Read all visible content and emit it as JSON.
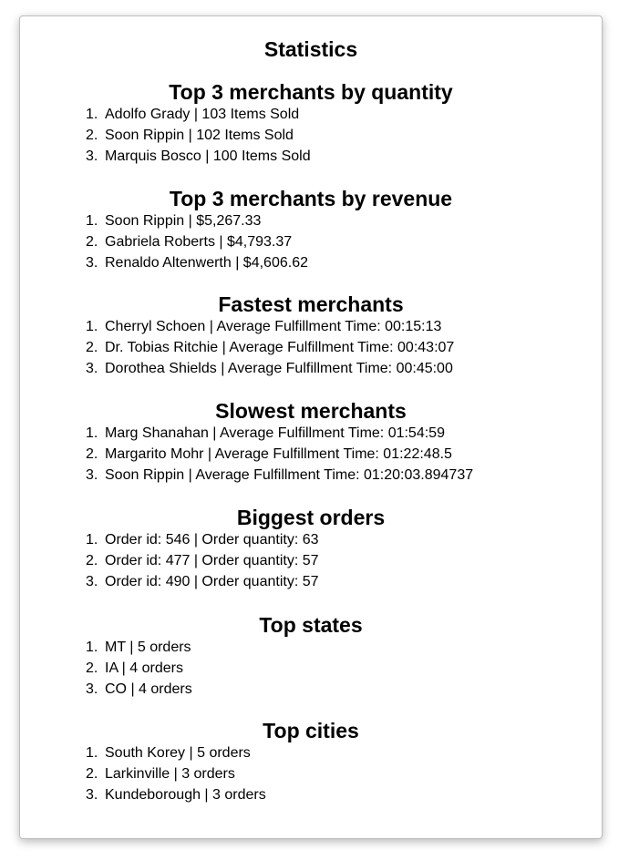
{
  "title": "Statistics",
  "sections": [
    {
      "heading": "Top 3 merchants by quantity",
      "items": [
        "Adolfo Grady | 103 Items Sold",
        "Soon Rippin | 102 Items Sold",
        "Marquis Bosco | 100 Items Sold"
      ]
    },
    {
      "heading": "Top 3 merchants by revenue",
      "items": [
        "Soon Rippin | $5,267.33",
        "Gabriela Roberts | $4,793.37",
        "Renaldo Altenwerth | $4,606.62"
      ]
    },
    {
      "heading": "Fastest merchants",
      "items": [
        "Cherryl Schoen | Average Fulfillment Time: 00:15:13",
        "Dr. Tobias Ritchie | Average Fulfillment Time: 00:43:07",
        "Dorothea Shields | Average Fulfillment Time: 00:45:00"
      ]
    },
    {
      "heading": "Slowest merchants",
      "items": [
        "Marg Shanahan | Average Fulfillment Time: 01:54:59",
        "Margarito Mohr | Average Fulfillment Time: 01:22:48.5",
        "Soon Rippin | Average Fulfillment Time: 01:20:03.894737"
      ]
    },
    {
      "heading": "Biggest orders",
      "items": [
        "Order id: 546 | Order quantity: 63",
        "Order id: 477 | Order quantity: 57",
        "Order id: 490 | Order quantity: 57"
      ]
    },
    {
      "heading": "Top states",
      "items": [
        "MT | 5 orders",
        "IA | 4 orders",
        "CO | 4 orders"
      ]
    },
    {
      "heading": "Top cities",
      "items": [
        "South Korey | 5 orders",
        "Larkinville | 3 orders",
        "Kundeborough | 3 orders"
      ]
    }
  ]
}
